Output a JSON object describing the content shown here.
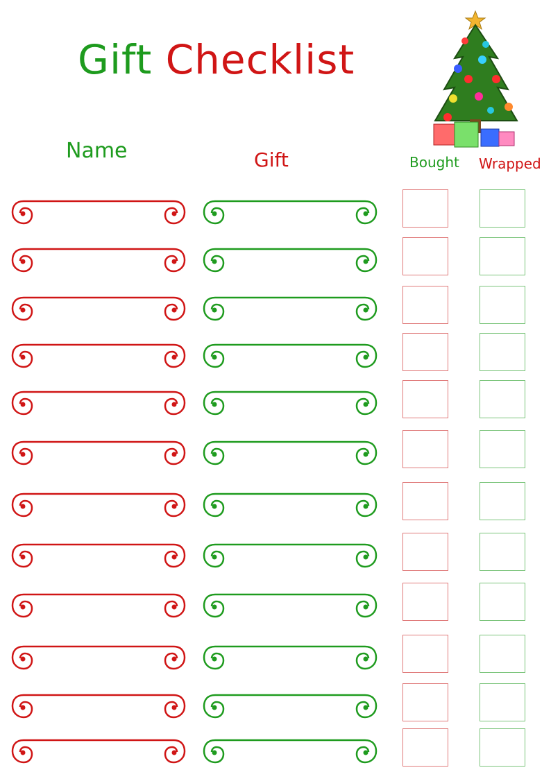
{
  "title": {
    "word1": "Gift",
    "word2": "Checklist"
  },
  "headers": {
    "name": "Name",
    "gift": "Gift",
    "bought": "Bought",
    "wrapped": "Wrapped"
  },
  "colors": {
    "red": "#d01515",
    "green": "#1e9b1e"
  },
  "decoration": {
    "icon": "christmas-tree-with-presents-icon"
  },
  "rows": [
    {
      "name": "",
      "gift": "",
      "bought": false,
      "wrapped": false
    },
    {
      "name": "",
      "gift": "",
      "bought": false,
      "wrapped": false
    },
    {
      "name": "",
      "gift": "",
      "bought": false,
      "wrapped": false
    },
    {
      "name": "",
      "gift": "",
      "bought": false,
      "wrapped": false
    },
    {
      "name": "",
      "gift": "",
      "bought": false,
      "wrapped": false
    },
    {
      "name": "",
      "gift": "",
      "bought": false,
      "wrapped": false
    },
    {
      "name": "",
      "gift": "",
      "bought": false,
      "wrapped": false
    },
    {
      "name": "",
      "gift": "",
      "bought": false,
      "wrapped": false
    },
    {
      "name": "",
      "gift": "",
      "bought": false,
      "wrapped": false
    },
    {
      "name": "",
      "gift": "",
      "bought": false,
      "wrapped": false
    },
    {
      "name": "",
      "gift": "",
      "bought": false,
      "wrapped": false
    },
    {
      "name": "",
      "gift": "",
      "bought": false,
      "wrapped": false
    }
  ]
}
